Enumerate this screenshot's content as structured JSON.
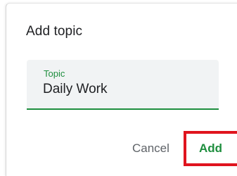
{
  "dialog": {
    "title": "Add topic",
    "field": {
      "label": "Topic",
      "value": "Daily Work"
    },
    "actions": {
      "cancel_label": "Cancel",
      "add_label": "Add"
    }
  },
  "colors": {
    "accent": "#1e8e3e",
    "highlight_border": "#e0141e",
    "field_background": "#f1f3f4",
    "text_primary": "#202124",
    "text_secondary": "#5f6368"
  }
}
